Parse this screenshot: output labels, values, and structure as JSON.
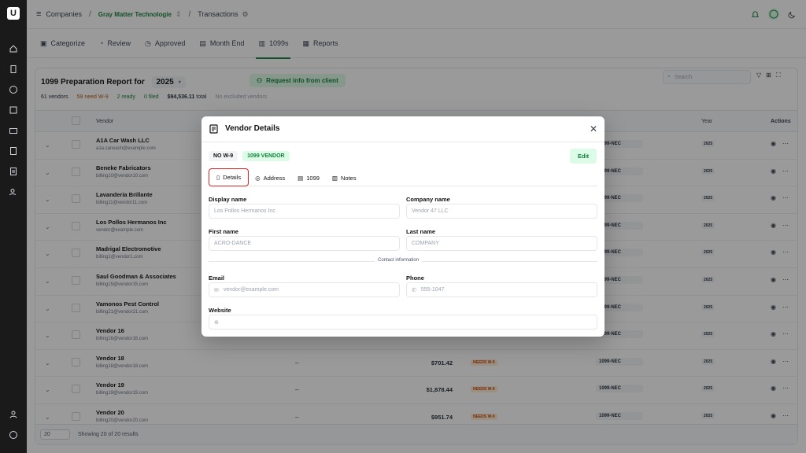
{
  "app": {
    "logo_glyph": "U"
  },
  "breadcrumb": {
    "root": "Companies",
    "company": "Gray Matter Technologie",
    "page": "Transactions"
  },
  "nav_tabs": [
    {
      "label": "Categorize",
      "icon": "categorize-icon"
    },
    {
      "label": "Review",
      "icon": "review-icon"
    },
    {
      "label": "Approved",
      "icon": "approved-icon"
    },
    {
      "label": "Month End",
      "icon": "calendar-icon"
    },
    {
      "label": "1099s",
      "icon": "document-icon",
      "active": true
    },
    {
      "label": "Reports",
      "icon": "bar-chart-icon"
    }
  ],
  "report": {
    "title": "1099 Preparation Report for",
    "year": "2025",
    "request_button": "Request info from client",
    "stats": {
      "vendors": "61 vendors",
      "need_w9": "59 need W-9",
      "ready": "2 ready",
      "filed": "0 filed",
      "total": "$94,536.11",
      "total_suffix": "total",
      "excluded": "No excluded vendors"
    },
    "search_placeholder": "Search",
    "columns": {
      "vendor": "Vendor",
      "type": "pe",
      "year": "Year",
      "actions": "Actions"
    },
    "rows": [
      {
        "name": "A1A Car Wash LLC",
        "email": "a1a.carwash@example.com",
        "tin": "",
        "amount": "",
        "status": "",
        "form": "1099-NEC",
        "year": "2025"
      },
      {
        "name": "Beneke Fabricators",
        "email": "billing10@vendor10.com",
        "tin": "",
        "amount": "",
        "status": "",
        "form": "1099-NEC",
        "year": "2025"
      },
      {
        "name": "Lavanderia Brillante",
        "email": "billing11@vendor11.com",
        "tin": "",
        "amount": "",
        "status": "",
        "form": "1099-NEC",
        "year": "2025"
      },
      {
        "name": "Los Pollos Hermanos Inc",
        "email": "vendor@example.com",
        "tin": "",
        "amount": "",
        "status": "",
        "form": "1099-NEC",
        "year": "2025"
      },
      {
        "name": "Madrigal Electromotive",
        "email": "billing1@vendor1.com",
        "tin": "",
        "amount": "",
        "status": "",
        "form": "1099-NEC",
        "year": "2025"
      },
      {
        "name": "Saul Goodman & Associates",
        "email": "billing15@vendor15.com",
        "tin": "",
        "amount": "",
        "status": "",
        "form": "1099-NEC",
        "year": "2025"
      },
      {
        "name": "Vamonos Pest Control",
        "email": "billing21@vendor21.com",
        "tin": "",
        "amount": "",
        "status": "",
        "form": "1099-NEC",
        "year": "2025"
      },
      {
        "name": "Vendor 16",
        "email": "billing16@vendor16.com",
        "tin": "",
        "amount": "",
        "status": "",
        "form": "1099-NEC",
        "year": "2025"
      },
      {
        "name": "Vendor 18",
        "email": "billing18@vendor18.com",
        "tin": "–",
        "amount": "$701.42",
        "status": "NEEDS W-9",
        "form": "1099-NEC",
        "year": "2025"
      },
      {
        "name": "Vendor 19",
        "email": "billing19@vendor19.com",
        "tin": "–",
        "amount": "$1,878.44",
        "status": "NEEDS W-9",
        "form": "1099-NEC",
        "year": "2025"
      },
      {
        "name": "Vendor 20",
        "email": "billing20@vendor20.com",
        "tin": "–",
        "amount": "$951.74",
        "status": "NEEDS W-9",
        "form": "1099-NEC",
        "year": "2025"
      }
    ],
    "page_size": "20",
    "results_text": "Showing 20 of 20 results"
  },
  "modal": {
    "title": "Vendor Details",
    "badges": [
      "NO W-9",
      "1099 VENDOR"
    ],
    "edit_button": "Edit",
    "tabs": [
      "Details",
      "Address",
      "1099",
      "Notes"
    ],
    "active_tab": "Details",
    "fields": {
      "display_name": {
        "label": "Display name",
        "placeholder": "Los Pollos Hermanos Inc"
      },
      "company_name": {
        "label": "Company name",
        "placeholder": "Vendor 47 LLC"
      },
      "first_name": {
        "label": "First name",
        "placeholder": "ACRO-DANCE"
      },
      "last_name": {
        "label": "Last name",
        "placeholder": "COMPANY"
      },
      "section_label": "Contact information",
      "email": {
        "label": "Email",
        "placeholder": "vendor@example.com"
      },
      "phone": {
        "label": "Phone",
        "placeholder": "555-1047"
      },
      "website": {
        "label": "Website",
        "placeholder": ""
      }
    }
  },
  "colors": {
    "brand": "#15803d",
    "sidebar": "#1a1a1a",
    "highlight": "#dc2626",
    "warning": "#c2410c"
  }
}
